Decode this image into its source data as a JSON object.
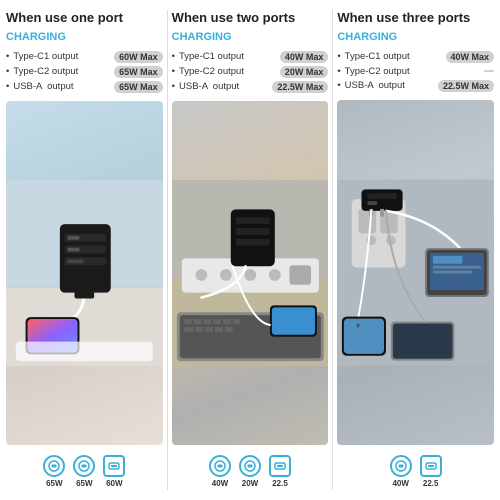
{
  "columns": [
    {
      "id": "one-port",
      "title": "When use one port",
      "charging": "CHARGING",
      "specs": [
        {
          "name": "Type-C1 output",
          "badge": "60W Max"
        },
        {
          "name": "Type-C2 output",
          "badge": "65W Max"
        },
        {
          "name": "USB-A   output",
          "badge": "65W Max"
        }
      ],
      "ports": [
        {
          "type": "usb-c",
          "watt": "65W"
        },
        {
          "type": "usb-c",
          "watt": "65W"
        },
        {
          "type": "usb-a",
          "watt": "60W"
        }
      ]
    },
    {
      "id": "two-ports",
      "title": "When use two ports",
      "charging": "CHARGING",
      "specs": [
        {
          "name": "Type-C1 output",
          "badge": "40W Max"
        },
        {
          "name": "Type-C2 output",
          "badge": "20W Max"
        },
        {
          "name": "USB-A   output",
          "badge": "22.5W Max"
        }
      ],
      "ports": [
        {
          "type": "usb-c",
          "watt": "40W"
        },
        {
          "type": "usb-c",
          "watt": "20W"
        },
        {
          "type": "usb-a",
          "watt": "22.5"
        }
      ]
    },
    {
      "id": "three-ports",
      "title": "When use three ports",
      "charging": "CHARGING",
      "specs": [
        {
          "name": "Type-C1 output",
          "badge": "40W Max"
        },
        {
          "name": "Type-C2 output",
          "badge": ""
        },
        {
          "name": "USB-A   output",
          "badge": "22.5W Max"
        }
      ],
      "ports": [
        {
          "type": "usb-c",
          "watt": "40W"
        },
        {
          "type": "usb-a",
          "watt": "22.5"
        }
      ]
    }
  ],
  "accent_color": "#3ab0d8"
}
